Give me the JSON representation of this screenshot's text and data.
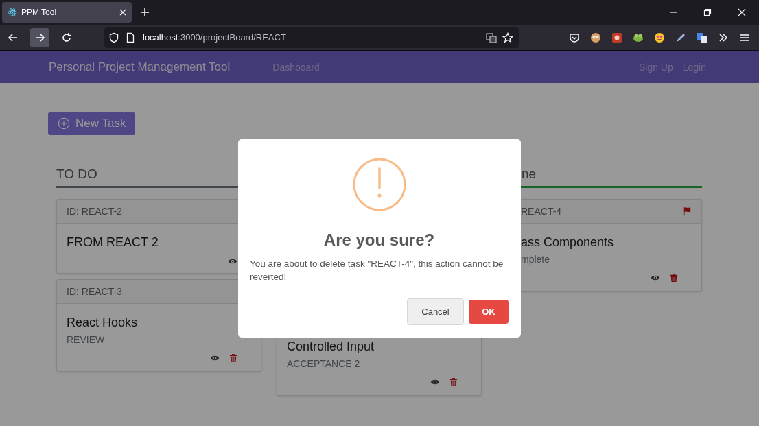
{
  "browser": {
    "tab_title": "PPM Tool",
    "url_host": "localhost",
    "url_rest": ":3000/projectBoard/REACT"
  },
  "navbar": {
    "brand": "Personal Project Management Tool",
    "links": [
      "Dashboard"
    ],
    "auth_links": [
      "Sign Up",
      "Login"
    ]
  },
  "new_task_button": "New Task",
  "columns": [
    {
      "title": "TO DO",
      "cards": [
        {
          "id": "ID: REACT-2",
          "title": "FROM REACT 2",
          "actions": [
            {
              "kind": "view"
            }
          ]
        },
        {
          "id": "ID: REACT-3",
          "title": "React Hooks",
          "status": "REVIEW",
          "actions": [
            {
              "kind": "view"
            },
            {
              "kind": "delete"
            }
          ]
        }
      ]
    },
    {
      "cards": [
        {
          "title": "Controlled Input",
          "status": "ACCEPTANCE 2",
          "actions": [
            {
              "kind": "view"
            },
            {
              "kind": "delete"
            }
          ]
        }
      ]
    },
    {
      "title": "ne",
      "cards": [
        {
          "id": "REACT-4",
          "title": "ass Components",
          "status": "mplete",
          "actions": [
            {
              "kind": "view"
            },
            {
              "kind": "delete"
            }
          ],
          "flagged": true
        }
      ]
    }
  ],
  "dialog": {
    "title": "Are you sure?",
    "message": "You are about to delete task \"REACT-4\", this action cannot be reverted!",
    "buttons": [
      {
        "label": "Cancel",
        "kind": "cancel"
      },
      {
        "label": "OK",
        "kind": "confirm"
      }
    ]
  }
}
